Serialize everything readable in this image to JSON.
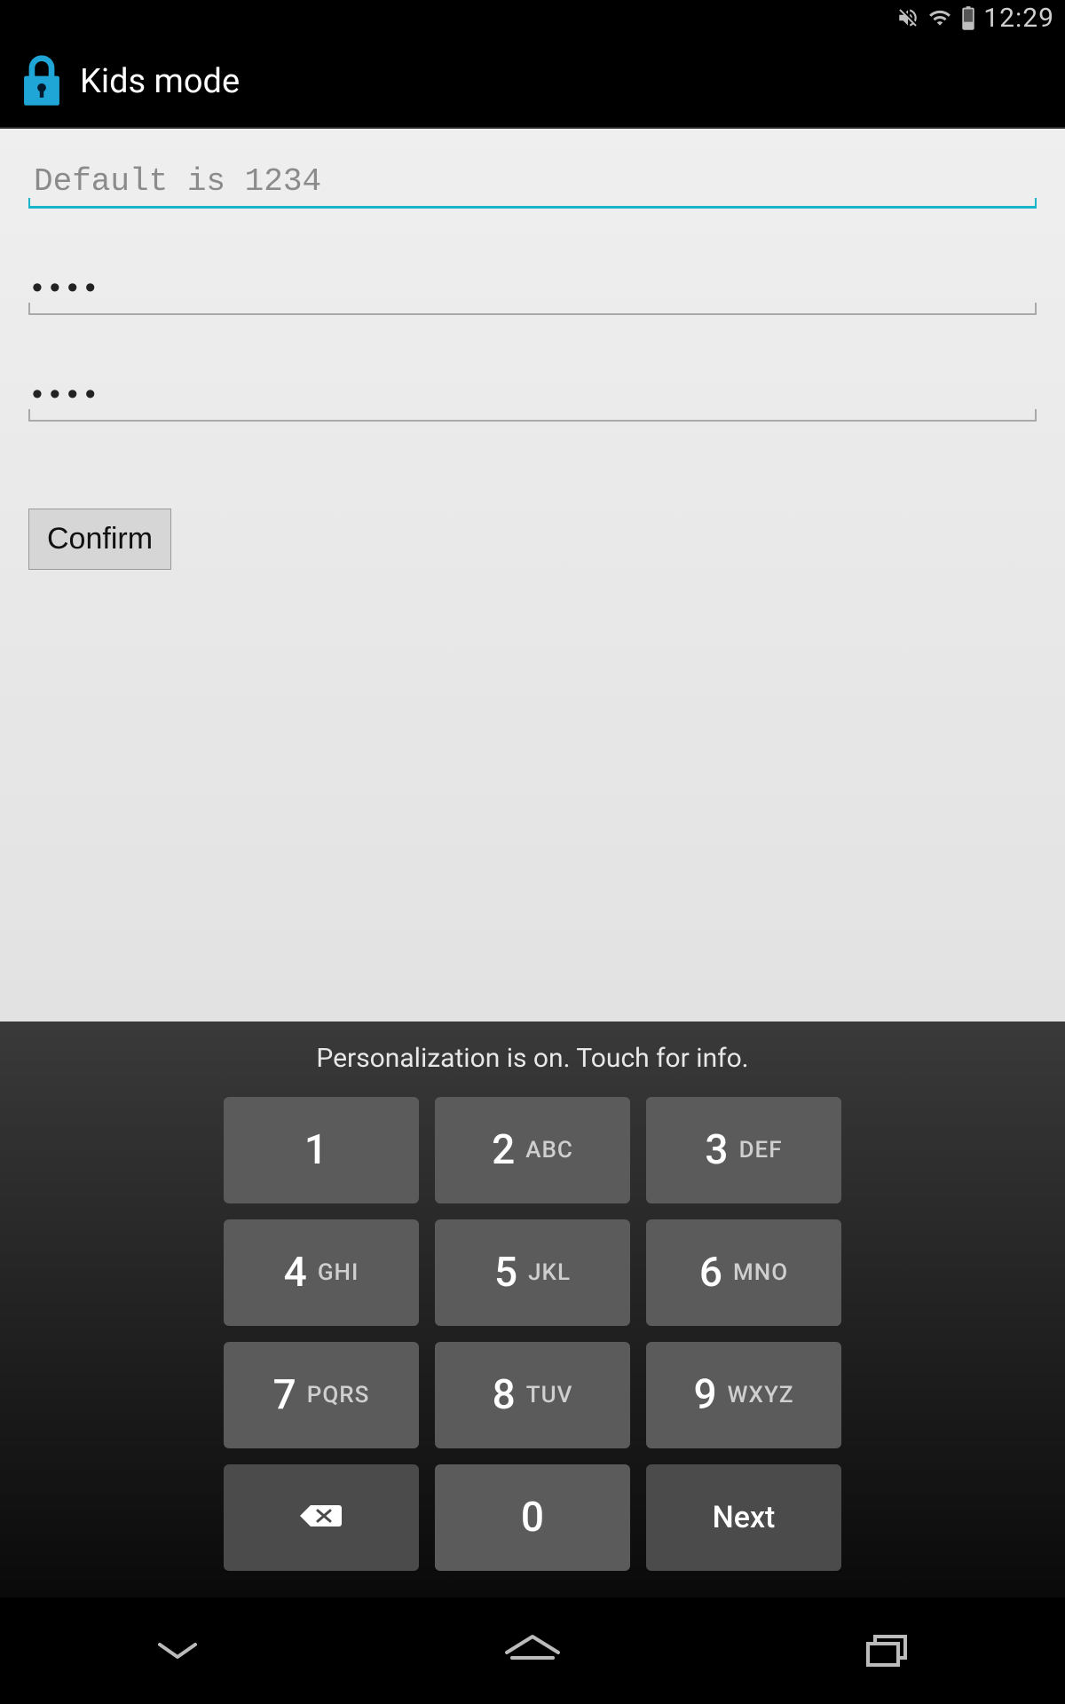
{
  "status": {
    "time": "12:29"
  },
  "app": {
    "title": "Kids mode"
  },
  "form": {
    "field1_placeholder": "Default is 1234",
    "field1_value": "",
    "field2_value": "••••",
    "field3_value": "••••",
    "confirm_label": "Confirm"
  },
  "keyboard": {
    "info_text": "Personalization is on. Touch for info.",
    "keys": [
      {
        "digit": "1",
        "letters": ""
      },
      {
        "digit": "2",
        "letters": "ABC"
      },
      {
        "digit": "3",
        "letters": "DEF"
      },
      {
        "digit": "4",
        "letters": "GHI"
      },
      {
        "digit": "5",
        "letters": "JKL"
      },
      {
        "digit": "6",
        "letters": "MNO"
      },
      {
        "digit": "7",
        "letters": "PQRS"
      },
      {
        "digit": "8",
        "letters": "TUV"
      },
      {
        "digit": "9",
        "letters": "WXYZ"
      }
    ],
    "zero": "0",
    "next": "Next"
  }
}
